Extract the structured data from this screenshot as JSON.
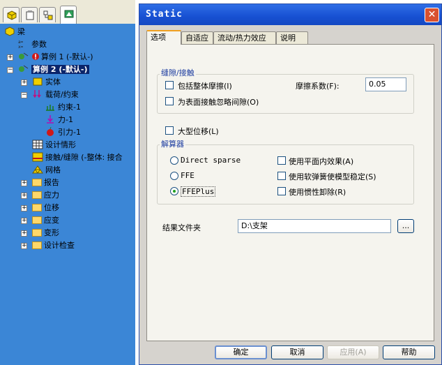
{
  "left_panel": {
    "tree": [
      {
        "label": "梁",
        "level": 0
      },
      {
        "label": "参数",
        "level": 1
      },
      {
        "label": "算例 1 (-默认-)",
        "level": 1
      },
      {
        "label": "算例 2 (-默认-)",
        "level": 1,
        "selected": true
      },
      {
        "label": "实体",
        "level": 2
      },
      {
        "label": "载荷/约束",
        "level": 2
      },
      {
        "label": "约束-1",
        "level": 3
      },
      {
        "label": "力-1",
        "level": 3
      },
      {
        "label": "引力-1",
        "level": 3
      },
      {
        "label": "设计情形",
        "level": 2
      },
      {
        "label": "接触/缝隙 (-整体: 接合",
        "level": 2
      },
      {
        "label": "网格",
        "level": 2
      },
      {
        "label": "报告",
        "level": 2
      },
      {
        "label": "应力",
        "level": 2
      },
      {
        "label": "位移",
        "level": 2
      },
      {
        "label": "应变",
        "level": 2
      },
      {
        "label": "变形",
        "level": 2
      },
      {
        "label": "设计检查",
        "level": 2
      }
    ]
  },
  "dialog": {
    "title": "Static",
    "tabs": [
      "选项",
      "自适应",
      "流动/热力效应",
      "说明"
    ],
    "gap_contact": {
      "group_label": "缝隙/接触",
      "include_friction": "包括整体摩擦(I)",
      "friction_label": "摩擦系数(F):",
      "friction_value": "0.05",
      "ignore_gap": "为表面接触忽略间隙(O)"
    },
    "large_displacement": "大型位移(L)",
    "solver": {
      "group_label": "解算器",
      "options": [
        "Direct sparse",
        "FFE",
        "FFEPlus"
      ],
      "selected": "FFEPlus",
      "checks": [
        "使用平面内效果(A)",
        "使用软弹簧使模型稳定(S)",
        "使用惯性卸除(R)"
      ]
    },
    "result_folder_label": "结果文件夹",
    "result_folder_value": "D:\\支架",
    "browse_label": "...",
    "buttons": {
      "ok": "确定",
      "cancel": "取消",
      "apply": "应用(A)",
      "help": "帮助"
    }
  }
}
